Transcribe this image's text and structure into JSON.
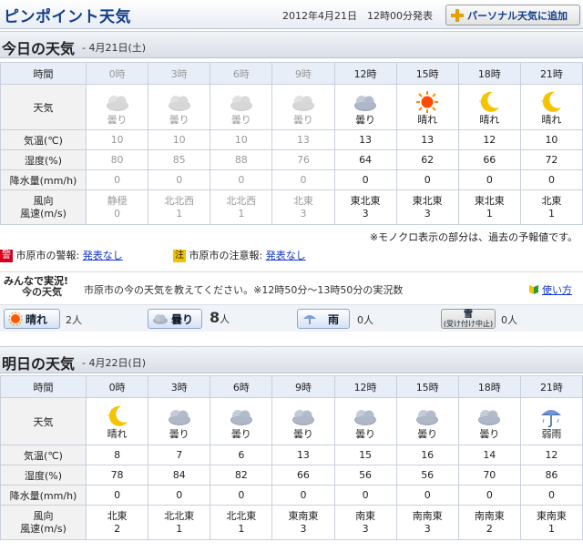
{
  "header": {
    "title": "ピンポイント天気",
    "issued": "2012年4月21日　12時00分発表",
    "personal_button": "パーソナル天気に追加"
  },
  "today": {
    "heading": "今日の天気",
    "date": "- 4月21日(土)",
    "labels": {
      "hour": "時間",
      "weather": "天気",
      "temp": "気温(℃)",
      "humidity": "湿度(%)",
      "precip": "降水量(mm/h)",
      "wind_dir": "風向",
      "wind_speed": "風速(m/s)"
    },
    "hours": [
      "0時",
      "3時",
      "6時",
      "9時",
      "12時",
      "15時",
      "18時",
      "21時"
    ],
    "past": [
      true,
      true,
      true,
      true,
      false,
      false,
      false,
      false
    ],
    "conditions": [
      "曇り",
      "曇り",
      "曇り",
      "曇り",
      "曇り",
      "晴れ",
      "晴れ",
      "晴れ"
    ],
    "icons": [
      "cloudy-icon",
      "cloudy-icon",
      "cloudy-icon",
      "cloudy-icon",
      "cloudy-icon",
      "sunny-icon",
      "clear-night-icon",
      "clear-night-icon"
    ],
    "temp": [
      "10",
      "10",
      "10",
      "13",
      "13",
      "13",
      "12",
      "10"
    ],
    "humidity": [
      "80",
      "85",
      "88",
      "76",
      "64",
      "62",
      "66",
      "72"
    ],
    "precip": [
      "0",
      "0",
      "0",
      "0",
      "0",
      "0",
      "0",
      "0"
    ],
    "wind_dir": [
      "静穏",
      "北北西",
      "北北西",
      "北東",
      "東北東",
      "東北東",
      "東北東",
      "北東"
    ],
    "wind_speed": [
      "0",
      "1",
      "1",
      "3",
      "3",
      "3",
      "1",
      "1"
    ]
  },
  "note": "※モノクロ表示の部分は、過去の予報値です。",
  "warnings": {
    "kei_badge": "警",
    "kei_label": "市原市の警報:",
    "kei_value": "発表なし",
    "chu_badge": "注",
    "chu_label": "市原市の注意報:",
    "chu_value": "発表なし"
  },
  "jikkyo": {
    "logo_line1": "みんなで実況!",
    "logo_line2": "今の天気",
    "message": "市原市の今の天気を教えてください。※12時50分～13時50分の実況数",
    "howto": "使い方",
    "sunny_label": "晴れ",
    "sunny_count": "2人",
    "cloudy_label": "曇り",
    "cloudy_count": "8",
    "cloudy_unit": "人",
    "rain_label": "雨",
    "rain_count": "0人",
    "snow_label": "雪",
    "snow_sub": "(受け付け中止)",
    "snow_count": "0人"
  },
  "tomorrow": {
    "heading": "明日の天気",
    "date": "- 4月22日(日)",
    "labels": {
      "hour": "時間",
      "weather": "天気",
      "temp": "気温(℃)",
      "humidity": "湿度(%)",
      "precip": "降水量(mm/h)",
      "wind_dir": "風向",
      "wind_speed": "風速(m/s)"
    },
    "hours": [
      "0時",
      "3時",
      "6時",
      "9時",
      "12時",
      "15時",
      "18時",
      "21時"
    ],
    "conditions": [
      "晴れ",
      "曇り",
      "曇り",
      "曇り",
      "曇り",
      "曇り",
      "曇り",
      "弱雨"
    ],
    "icons": [
      "clear-night-icon",
      "cloudy-icon",
      "cloudy-icon",
      "cloudy-icon",
      "cloudy-icon",
      "cloudy-icon",
      "cloudy-icon",
      "light-rain-icon"
    ],
    "temp": [
      "8",
      "7",
      "6",
      "13",
      "15",
      "16",
      "14",
      "12"
    ],
    "humidity": [
      "78",
      "84",
      "82",
      "66",
      "56",
      "56",
      "70",
      "86"
    ],
    "precip": [
      "0",
      "0",
      "0",
      "0",
      "0",
      "0",
      "0",
      "0"
    ],
    "wind_dir": [
      "北東",
      "北北東",
      "北北東",
      "東南東",
      "南東",
      "南南東",
      "南南東",
      "東南東"
    ],
    "wind_speed": [
      "2",
      "1",
      "1",
      "3",
      "3",
      "3",
      "2",
      "1"
    ]
  },
  "colors": {
    "accent": "#123e8a",
    "header_bg": "#e8eef8",
    "label_bg": "#f2f2f2",
    "past_text": "#999999",
    "sun": "#ff5a00",
    "moon": "#f5c400"
  }
}
